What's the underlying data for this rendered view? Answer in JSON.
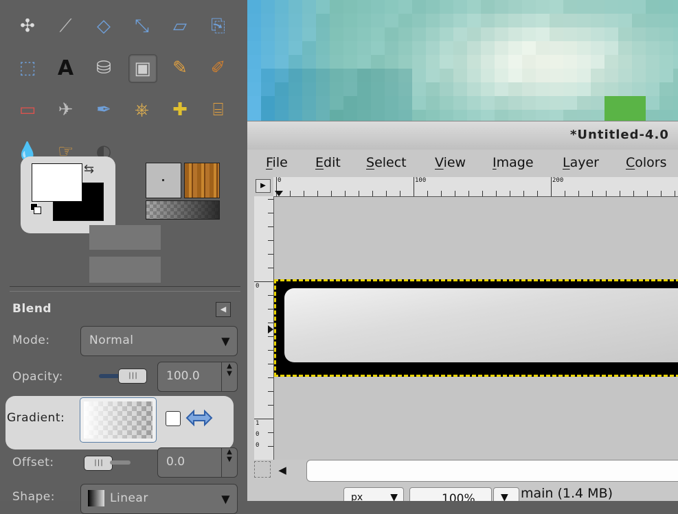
{
  "toolbox": {
    "tools": [
      {
        "name": "move-tool-icon",
        "glyph": "✣"
      },
      {
        "name": "measure-tool-icon",
        "glyph": "⟋"
      },
      {
        "name": "rotate-tool-icon",
        "glyph": "◇"
      },
      {
        "name": "scale-tool-icon",
        "glyph": "⤡"
      },
      {
        "name": "perspective-tool-icon",
        "glyph": "▱"
      },
      {
        "name": "flip-tool-icon",
        "glyph": "⎘"
      },
      {
        "name": "cage-tool-icon",
        "glyph": "⬚"
      },
      {
        "name": "text-tool-icon",
        "glyph": "A"
      },
      {
        "name": "bucket-fill-tool-icon",
        "glyph": "⛁"
      },
      {
        "name": "blend-tool-icon",
        "glyph": "▣"
      },
      {
        "name": "pencil-tool-icon",
        "glyph": "✎"
      },
      {
        "name": "paintbrush-tool-icon",
        "glyph": "✐"
      },
      {
        "name": "eraser-tool-icon",
        "glyph": "▭"
      },
      {
        "name": "airbrush-tool-icon",
        "glyph": "✈"
      },
      {
        "name": "ink-tool-icon",
        "glyph": "✒"
      },
      {
        "name": "clone-tool-icon",
        "glyph": "⎈"
      },
      {
        "name": "heal-tool-icon",
        "glyph": "✚"
      },
      {
        "name": "perspective-clone-tool-icon",
        "glyph": "⌸"
      },
      {
        "name": "blur-tool-icon",
        "glyph": "💧"
      },
      {
        "name": "smudge-tool-icon",
        "glyph": "☞"
      },
      {
        "name": "dodge-burn-tool-icon",
        "glyph": "◐"
      }
    ],
    "active_tool": "blend-tool-icon"
  },
  "tool_options": {
    "title": "Blend",
    "mode_label": "Mode:",
    "mode_value": "Normal",
    "opacity_label": "Opacity:",
    "opacity_value": "100.0",
    "opacity_fraction": 1.0,
    "gradient_label": "Gradient:",
    "offset_label": "Offset:",
    "offset_value": "0.0",
    "shape_label": "Shape:",
    "shape_value": "Linear"
  },
  "image_window": {
    "title": "*Untitled-4.0",
    "menus": [
      {
        "label": "File",
        "mnemonic": "F"
      },
      {
        "label": "Edit",
        "mnemonic": "E"
      },
      {
        "label": "Select",
        "mnemonic": "S"
      },
      {
        "label": "View",
        "mnemonic": "V"
      },
      {
        "label": "Image",
        "mnemonic": "I"
      },
      {
        "label": "Layer",
        "mnemonic": "L"
      },
      {
        "label": "Colors",
        "mnemonic": "C"
      }
    ],
    "hruler_labels": [
      "0",
      "100",
      "200"
    ],
    "vruler_labels": [
      "0",
      "1",
      "0",
      "0"
    ],
    "status": {
      "unit": "px",
      "zoom": "100%",
      "text": "main (1.4 MB)"
    }
  },
  "colors": {
    "toolbox_bg": "#5f5f5f",
    "highlight_bg": "#d9d9d9",
    "selection_ants": "#e8d300",
    "foreground": "#ffffff",
    "background": "#000000"
  }
}
